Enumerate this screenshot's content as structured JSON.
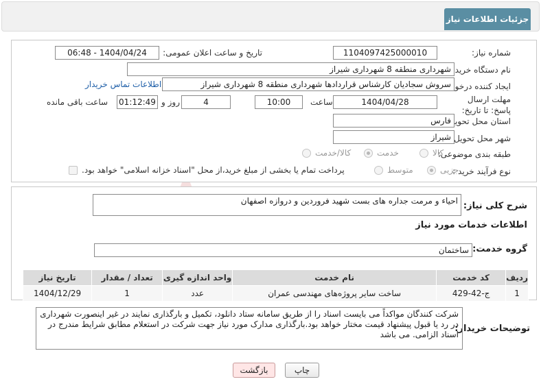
{
  "header": {
    "title": "جزئیات اطلاعات نیاز"
  },
  "form": {
    "need_number": {
      "label": "شماره نیاز:",
      "value": "1104097425000010"
    },
    "announce_datetime": {
      "label": "تاریخ و ساعت اعلان عمومی:",
      "value": "1404/04/24 - 06:48"
    },
    "buyer_org": {
      "label": "نام دستگاه خریدار:",
      "value": "شهرداری منطقه 8 شهرداری شیراز"
    },
    "requester": {
      "label": "ایجاد کننده درخواست:",
      "value": "سروش سجادیان کارشناس قراردادها شهرداری منطقه 8 شهرداری شیراز",
      "contact_link": "اطلاعات تماس خریدار"
    },
    "deadline": {
      "label": "مهلت ارسال پاسخ: تا تاریخ:",
      "date": "1404/04/28",
      "time_label": "ساعت",
      "time": "10:00",
      "days": "4",
      "days_label": "روز و",
      "remaining": "01:12:49",
      "remaining_label": "ساعت باقی مانده"
    },
    "province": {
      "label": "استان محل تحویل:",
      "value": "فارس"
    },
    "city": {
      "label": "شهر محل تحویل:",
      "value": "شیراز"
    },
    "category": {
      "label": "طبقه بندی موضوعی:",
      "options": [
        "کالا",
        "خدمت",
        "کالا/خدمت"
      ],
      "selected": "خدمت"
    },
    "process_type": {
      "label": "نوع فرآیند خرید :",
      "options": [
        "جزیی",
        "متوسط"
      ],
      "selected": "جزیی",
      "note": "پرداخت تمام یا بخشی از مبلغ خرید،از محل \"اسناد خزانه اسلامی\" خواهد بود."
    }
  },
  "summary": {
    "label": "شرح کلی نیاز:",
    "value": "احیاء و مرمت جداره های بست شهید فروردین و دروازه اصفهان"
  },
  "services": {
    "title": "اطلاعات خدمات مورد نیاز",
    "group_label": "گروه خدمت:",
    "group_value": "ساختمان",
    "columns": [
      "ردیف",
      "کد خدمت",
      "نام خدمت",
      "واحد اندازه گیری",
      "تعداد / مقدار",
      "تاریخ نیاز"
    ],
    "rows": [
      [
        "1",
        "ج-42-429",
        "ساخت سایر پروژه‌های مهندسی عمران",
        "عدد",
        "1",
        "1404/12/29"
      ]
    ]
  },
  "buyer_notes": {
    "label": "توضیحات خریدار:",
    "value": "شرکت کنندگان مواکداً می بایست اسناد را از طریق سامانه ستاد دانلود، تکمیل و بارگذاری نمایند در غیر اینصورت شهرداری در رد یا قبول پیشنهاد قیمت مختار خواهد بود.بارگذاری مدارک مورد نیاز جهت شرکت در استعلام مطابق شرایط مندرج در اسناد الزامی. می باشد"
  },
  "buttons": {
    "print": "چاپ",
    "back": "بازگشت"
  },
  "watermark": {
    "text": "AriaTender.net"
  }
}
